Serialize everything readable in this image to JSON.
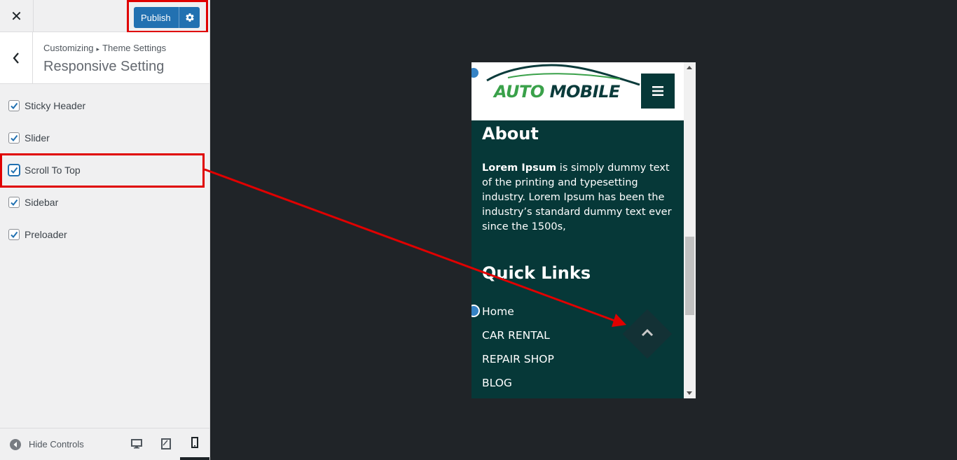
{
  "topbar": {
    "close_icon": "close-icon",
    "publish_label": "Publish",
    "settings_icon": "gear-icon"
  },
  "section": {
    "breadcrumb_parent": "Customizing",
    "breadcrumb_separator": "▸",
    "breadcrumb_current": "Theme Settings",
    "title": "Responsive Setting"
  },
  "options": [
    {
      "label": "Sticky Header",
      "checked": true
    },
    {
      "label": "Slider",
      "checked": true
    },
    {
      "label": "Scroll To Top",
      "checked": true
    },
    {
      "label": "Sidebar",
      "checked": true
    },
    {
      "label": "Preloader",
      "checked": true
    }
  ],
  "footer": {
    "hide_controls_label": "Hide Controls",
    "devices": [
      "desktop",
      "tablet",
      "mobile"
    ],
    "active_device": "mobile"
  },
  "preview": {
    "logo": {
      "part1": "AUTO",
      "part2": "MOBILE"
    },
    "about_heading": "About",
    "about_bold": "Lorem Ipsum",
    "about_text": " is simply dummy text of the printing and typesetting industry. Lorem Ipsum has been the industry’s standard dummy text ever since the 1500s,",
    "links_heading": "Quick Links",
    "links": [
      "Home",
      "CAR RENTAL",
      "REPAIR SHOP",
      "BLOG"
    ]
  },
  "colors": {
    "accent": "#2271b1",
    "annotation": "#e00000",
    "footer_bg": "#063838",
    "logo_green": "#3aa14a"
  }
}
